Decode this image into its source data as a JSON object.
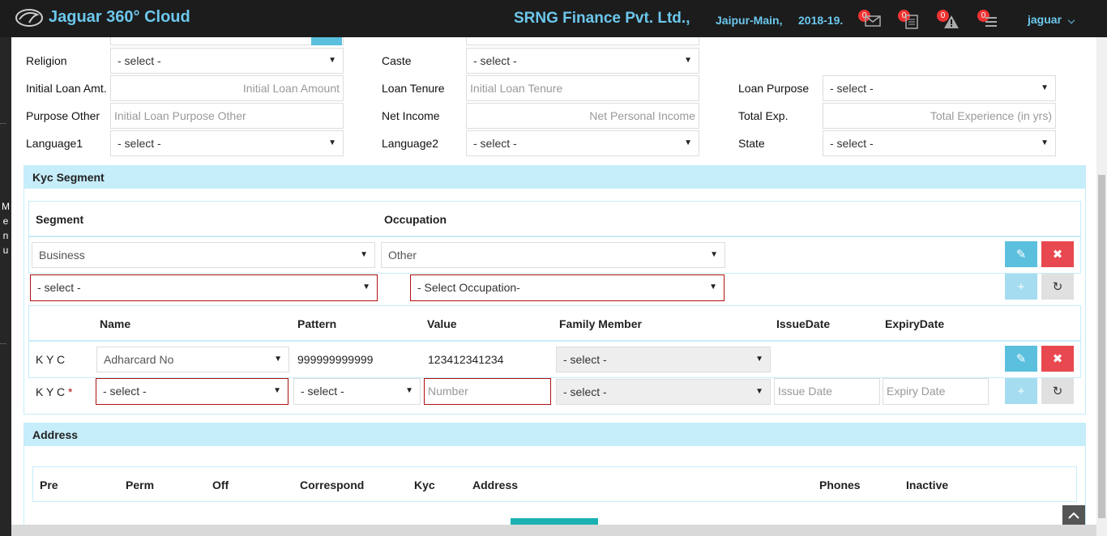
{
  "header": {
    "app_title": "Jaguar 360° Cloud",
    "company": "SRNG Finance Pvt. Ltd.,",
    "branch": "Jaipur-Main,",
    "fiscal_year": "2018-19.",
    "notifications": [
      {
        "icon": "mail-icon",
        "count": "0"
      },
      {
        "icon": "document-icon",
        "count": "0"
      },
      {
        "icon": "warning-icon",
        "count": "0"
      },
      {
        "icon": "list-icon",
        "count": "0"
      }
    ],
    "user": "jaguar",
    "user_caret": "⌵"
  },
  "sidebar": {
    "menu_letters": [
      "M",
      "e",
      "n",
      "u"
    ]
  },
  "form": {
    "religion_label": "Religion",
    "religion_value": "- select -",
    "caste_label": "Caste",
    "caste_value": "- select -",
    "initial_loan_label": "Initial Loan Amt.",
    "initial_loan_placeholder": "Initial Loan Amount",
    "loan_tenure_label": "Loan Tenure",
    "loan_tenure_placeholder": "Initial Loan Tenure",
    "loan_purpose_label": "Loan Purpose",
    "loan_purpose_value": "- select -",
    "purpose_other_label": "Purpose Other",
    "purpose_other_placeholder": "Initial Loan Purpose Other",
    "net_income_label": "Net Income",
    "net_income_placeholder": "Net Personal Income",
    "total_exp_label": "Total Exp.",
    "total_exp_placeholder": "Total Experience (in yrs)",
    "language1_label": "Language1",
    "language1_value": "- select -",
    "language2_label": "Language2",
    "language2_value": "- select -",
    "state_label": "State",
    "state_value": "- select -"
  },
  "kyc_segment": {
    "title": "Kyc Segment",
    "col_segment": "Segment",
    "col_occupation": "Occupation",
    "row_segment": "Business",
    "row_occupation": "Other",
    "new_segment": "- select -",
    "new_occupation": "- Select Occupation-",
    "kyc_cols": [
      "Name",
      "Pattern",
      "Value",
      "Family Member",
      "IssueDate",
      "ExpiryDate"
    ],
    "kyc_row": {
      "label": "K Y C",
      "name": "Adharcard No",
      "pattern": "999999999999",
      "value": "123412341234",
      "family_member": "- select -"
    },
    "kyc_new": {
      "label": "K Y C",
      "required": "*",
      "name": "- select -",
      "pattern": "- select -",
      "value_placeholder": "Number",
      "family_member": "- select -",
      "issue_placeholder": "Issue Date",
      "expiry_placeholder": "Expiry Date"
    }
  },
  "address": {
    "title": "Address",
    "cols": [
      "Pre",
      "Perm",
      "Off",
      "Correspond",
      "Kyc",
      "Address",
      "Phones",
      "Inactive"
    ]
  },
  "icons": {
    "arrow": "▼",
    "edit": "✎",
    "delete": "✖",
    "add": "+",
    "reset": "↻"
  }
}
